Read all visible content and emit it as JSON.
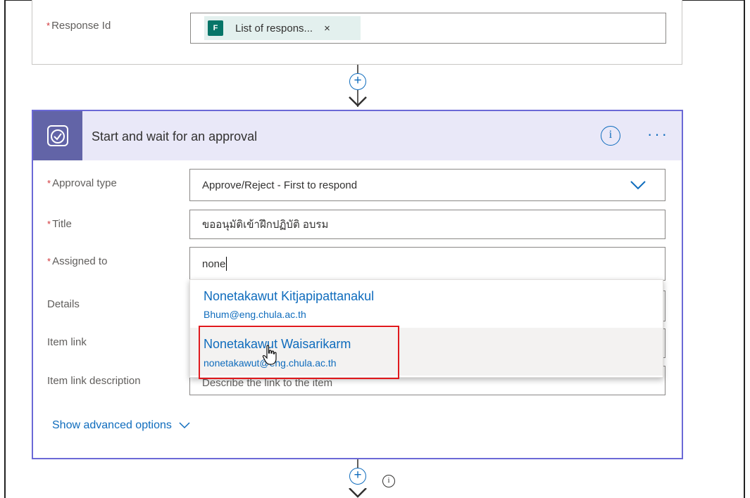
{
  "previous_step": {
    "response_id_label": "Response Id",
    "token_text": "List of respons...",
    "token_close": "×"
  },
  "approval_card": {
    "title": "Start and wait for an approval",
    "info_glyph": "i",
    "more_glyph": "···",
    "fields": {
      "approval_type_label": "Approval type",
      "approval_type_value": "Approve/Reject - First to respond",
      "title_label": "Title",
      "title_value": "ขออนุมัติเข้าฝึกปฏิบัติ อบรม",
      "assigned_to_label": "Assigned to",
      "assigned_to_value": "none",
      "details_label": "Details",
      "item_link_label": "Item link",
      "item_link_description_label": "Item link description",
      "item_link_description_placeholder": "Describe the link to the item"
    },
    "show_advanced": "Show advanced options"
  },
  "suggestions": [
    {
      "name": "Nonetakawut Kitjapipattanakul",
      "email": "Bhum@eng.chula.ac.th"
    },
    {
      "name": "Nonetakawut Waisarikarm",
      "email": "nonetakawut@eng.chula.ac.th"
    }
  ],
  "required_mark": "*",
  "icons": [
    "forms-icon",
    "approval-icon",
    "info-icon",
    "more-icon",
    "chevron-down-icon",
    "plus-icon",
    "arrow-down-icon",
    "hand-cursor-icon"
  ],
  "colors": {
    "accent": "#0f6cbd",
    "card_border": "#6b69d6",
    "card_header": "#e9e8f8",
    "approval_icon_bg": "#6264a7",
    "highlight": "#e0191d"
  }
}
